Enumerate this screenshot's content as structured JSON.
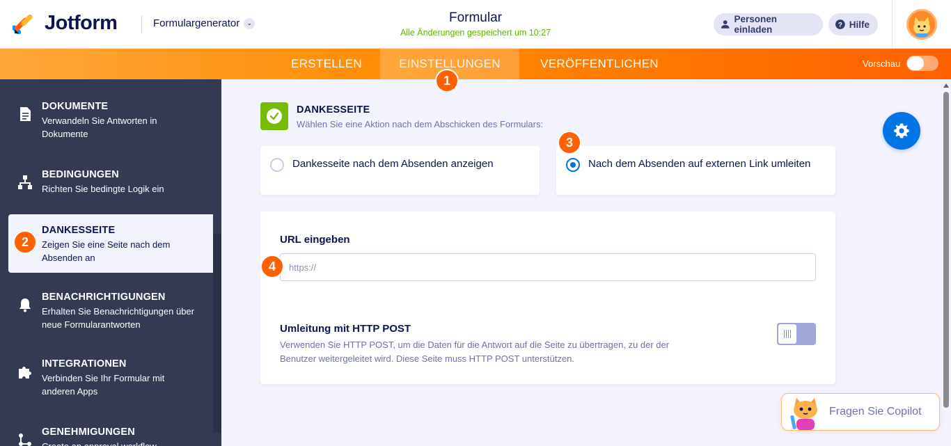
{
  "header": {
    "logo_text": "Jotform",
    "builder_select": "Formulargenerator",
    "form_title": "Formular",
    "save_status": "Alle Änderungen gespeichert um 10:27",
    "invite_button": "Personen einladen",
    "help_button": "Hilfe"
  },
  "tabs": {
    "create": "ERSTELLEN",
    "settings": "EINSTELLUNGEN",
    "publish": "VERÖFFENTLICHEN",
    "preview_label": "Vorschau",
    "preview_on": false
  },
  "badges": [
    "1",
    "2",
    "3",
    "4"
  ],
  "sidebar": {
    "items": [
      {
        "title": "DOKUMENTE",
        "desc": "Verwandeln Sie Antworten in Dokumente",
        "icon": "document-icon"
      },
      {
        "title": "BEDINGUNGEN",
        "desc": "Richten Sie bedingte Logik ein",
        "icon": "conditions-icon"
      },
      {
        "title": "DANKESSEITE",
        "desc": "Zeigen Sie eine Seite nach dem Absenden an",
        "icon": "thankyou-icon",
        "active": true
      },
      {
        "title": "BENACHRICHTIGUNGEN",
        "desc": "Erhalten Sie Benachrichtigungen über neue Formularantworten",
        "icon": "bell-icon"
      },
      {
        "title": "INTEGRATIONEN",
        "desc": "Verbinden Sie Ihr Formular mit anderen Apps",
        "icon": "puzzle-icon"
      },
      {
        "title": "GENEHMIGUNGEN",
        "desc": "Create an approval workflow",
        "icon": "approval-icon"
      }
    ]
  },
  "main": {
    "section_title": "DANKESSEITE",
    "section_desc": "Wählen Sie eine Aktion nach dem Abschicken des Formulars:",
    "option_show_page": "Dankesseite nach dem Absenden anzeigen",
    "option_redirect": "Nach dem Absenden auf externen Link umleiten",
    "selected_option": "redirect",
    "url_label": "URL eingeben",
    "url_placeholder": "https://",
    "url_value": "",
    "post_title": "Umleitung mit HTTP POST",
    "post_desc": "Verwenden Sie HTTP POST, um die Daten für die Antwort auf die Seite zu übertragen, zu der der Benutzer weitergeleitet wird. Diese Seite muss HTTP POST unterstützen.",
    "post_enabled": false
  },
  "copilot": {
    "label": "Fragen Sie Copilot"
  },
  "colors": {
    "brand_orange": "#ff6100",
    "accent_blue": "#0075e3",
    "success_green": "#78bb07",
    "sidebar_bg": "#333a52",
    "navy_text": "#0a1551"
  }
}
